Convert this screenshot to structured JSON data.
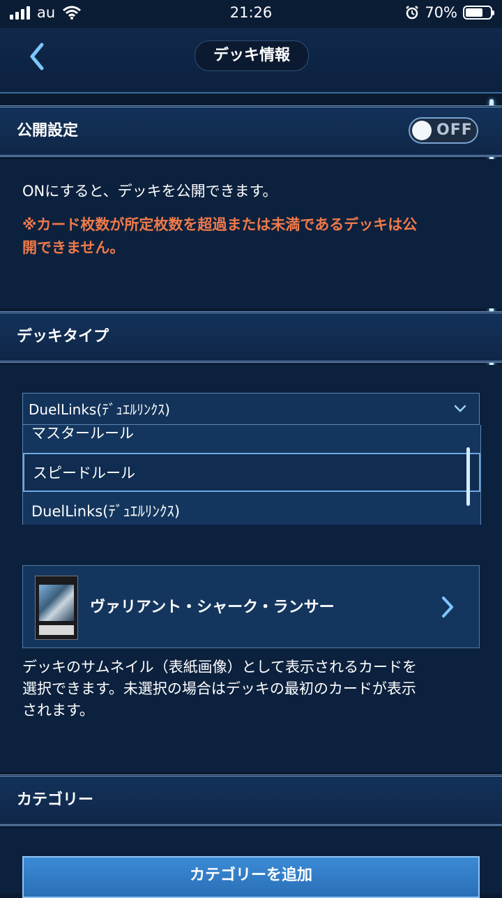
{
  "status_bar": {
    "carrier": "au",
    "time": "21:26",
    "battery": "70%",
    "battery_level": 0.7
  },
  "header": {
    "title": "デッキ情報"
  },
  "public_setting": {
    "label": "公開設定",
    "toggle_state": "OFF",
    "description": "ONにすると、デッキを公開できます。",
    "warning_line1": "※カード枚数が所定枚数を超過または未満であるデッキは公",
    "warning_line2": "開できません。"
  },
  "deck_type": {
    "label": "デッキタイプ",
    "selected_value": "DuelLinks(ﾃﾞｭｴﾙﾘﾝｸｽ)",
    "options": [
      "マスタールール",
      "スピードルール",
      "DuelLinks(ﾃﾞｭｴﾙﾘﾝｸｽ)"
    ],
    "highlighted_option": "スピードルール"
  },
  "thumbnail": {
    "card_name": "ヴァリアント・シャーク・ランサー",
    "help_line1": "デッキのサムネイル（表紙画像）として表示されるカードを",
    "help_line2": "選択できます。未選択の場合はデッキの最初のカードが表示",
    "help_line3": "されます。"
  },
  "category": {
    "label": "カテゴリー",
    "add_button": "カテゴリーを追加"
  },
  "colors": {
    "background": "#0a1a30",
    "warning": "#f07a4a",
    "accent": "#3b8ad6"
  }
}
